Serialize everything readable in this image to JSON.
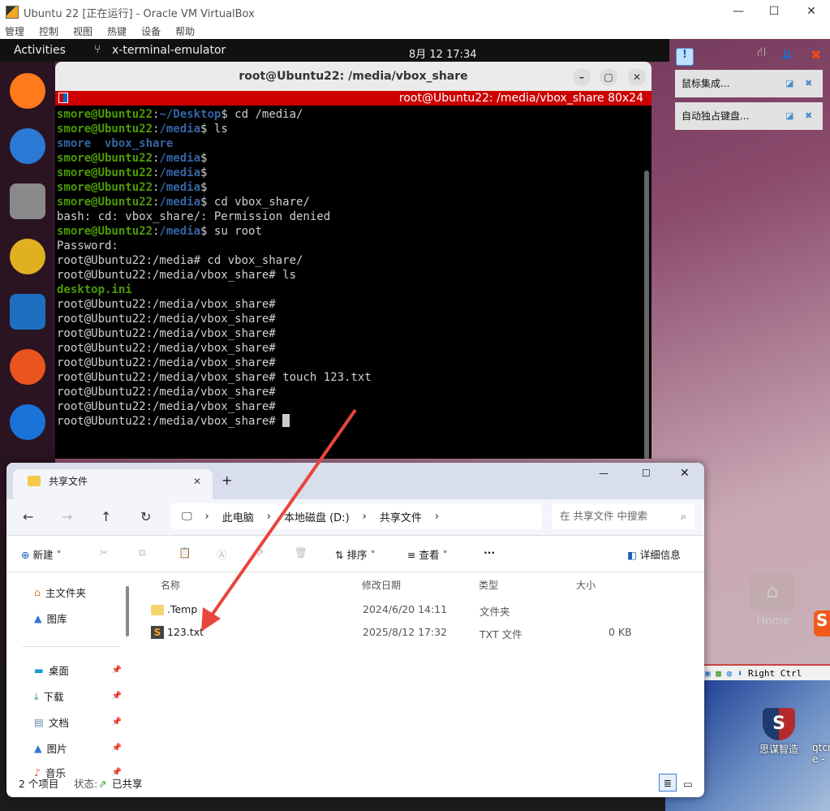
{
  "vbox": {
    "title": "Ubuntu 22 [正在运行] - Oracle VM VirtualBox",
    "menu": [
      "管理",
      "控制",
      "视图",
      "热键",
      "设备",
      "帮助"
    ],
    "status_key": "Right Ctrl"
  },
  "ubuntu": {
    "activities": "Activities",
    "app": "x-terminal-emulator",
    "clock": "8月 12  17:34",
    "home_label": "Home",
    "dock": [
      {
        "name": "firefox-icon",
        "color": "#ff7a1a"
      },
      {
        "name": "thunderbird-icon",
        "color": "#2a7ad5"
      },
      {
        "name": "files-icon",
        "color": "#8a8a8a"
      },
      {
        "name": "rhythmbox-icon",
        "color": "#e0b020"
      },
      {
        "name": "writer-icon",
        "color": "#1e6fc0"
      },
      {
        "name": "app-center-icon",
        "color": "#e9541f"
      },
      {
        "name": "help-icon",
        "color": "#1a73d8"
      }
    ]
  },
  "notifications": [
    {
      "label": "鼠标集成..."
    },
    {
      "label": "自动独占键盘..."
    }
  ],
  "terminal": {
    "title": "root@Ubuntu22: /media/vbox_share",
    "subtitle": "root@Ubuntu22: /media/vbox_share 80x24",
    "lines": [
      [
        {
          "t": "smore@Ubuntu22",
          "c": "u"
        },
        {
          "t": ":",
          "c": "n"
        },
        {
          "t": "~/Desktop",
          "c": "p"
        },
        {
          "t": "$ cd /media/",
          "c": "n"
        }
      ],
      [
        {
          "t": "smore@Ubuntu22",
          "c": "u"
        },
        {
          "t": ":",
          "c": "n"
        },
        {
          "t": "/media",
          "c": "p"
        },
        {
          "t": "$ ls",
          "c": "n"
        }
      ],
      [
        {
          "t": "smore  vbox_share",
          "c": "b"
        }
      ],
      [
        {
          "t": "smore@Ubuntu22",
          "c": "u"
        },
        {
          "t": ":",
          "c": "n"
        },
        {
          "t": "/media",
          "c": "p"
        },
        {
          "t": "$",
          "c": "n"
        }
      ],
      [
        {
          "t": "smore@Ubuntu22",
          "c": "u"
        },
        {
          "t": ":",
          "c": "n"
        },
        {
          "t": "/media",
          "c": "p"
        },
        {
          "t": "$",
          "c": "n"
        }
      ],
      [
        {
          "t": "smore@Ubuntu22",
          "c": "u"
        },
        {
          "t": ":",
          "c": "n"
        },
        {
          "t": "/media",
          "c": "p"
        },
        {
          "t": "$",
          "c": "n"
        }
      ],
      [
        {
          "t": "smore@Ubuntu22",
          "c": "u"
        },
        {
          "t": ":",
          "c": "n"
        },
        {
          "t": "/media",
          "c": "p"
        },
        {
          "t": "$ cd vbox_share/",
          "c": "n"
        }
      ],
      [
        {
          "t": "bash: cd: vbox_share/: Permission denied",
          "c": "n"
        }
      ],
      [
        {
          "t": "smore@Ubuntu22",
          "c": "u"
        },
        {
          "t": ":",
          "c": "n"
        },
        {
          "t": "/media",
          "c": "p"
        },
        {
          "t": "$ su root",
          "c": "n"
        }
      ],
      [
        {
          "t": "Password:",
          "c": "n"
        }
      ],
      [
        {
          "t": "root@Ubuntu22:/media# cd vbox_share/",
          "c": "n"
        }
      ],
      [
        {
          "t": "root@Ubuntu22:/media/vbox_share# ls",
          "c": "n"
        }
      ],
      [
        {
          "t": "desktop.ini",
          "c": "g"
        }
      ],
      [
        {
          "t": "root@Ubuntu22:/media/vbox_share#",
          "c": "n"
        }
      ],
      [
        {
          "t": "root@Ubuntu22:/media/vbox_share#",
          "c": "n"
        }
      ],
      [
        {
          "t": "root@Ubuntu22:/media/vbox_share#",
          "c": "n"
        }
      ],
      [
        {
          "t": "root@Ubuntu22:/media/vbox_share#",
          "c": "n"
        }
      ],
      [
        {
          "t": "root@Ubuntu22:/media/vbox_share#",
          "c": "n"
        }
      ],
      [
        {
          "t": "root@Ubuntu22:/media/vbox_share# touch 123.txt",
          "c": "n"
        }
      ],
      [
        {
          "t": "root@Ubuntu22:/media/vbox_share#",
          "c": "n"
        }
      ],
      [
        {
          "t": "root@Ubuntu22:/media/vbox_share#",
          "c": "n"
        }
      ],
      [
        {
          "t": "root@Ubuntu22:/media/vbox_share# ",
          "c": "n"
        }
      ]
    ]
  },
  "explorer": {
    "tab": "共享文件",
    "crumbs": [
      "此电脑",
      "本地磁盘 (D:)",
      "共享文件"
    ],
    "search_placeholder": "在 共享文件 中搜索",
    "toolbar": {
      "new": "新建",
      "sort": "排序",
      "view": "查看",
      "more": "···",
      "details": "详细信息"
    },
    "nav": [
      {
        "label": "主文件夹",
        "icon": "home-icon"
      },
      {
        "label": "图库",
        "icon": "gallery-icon"
      },
      {
        "label": "桌面",
        "icon": "desktop-icon"
      },
      {
        "label": "下载",
        "icon": "download-icon"
      },
      {
        "label": "文档",
        "icon": "documents-icon"
      },
      {
        "label": "图片",
        "icon": "pictures-icon"
      },
      {
        "label": "音乐",
        "icon": "music-icon"
      }
    ],
    "columns": [
      "名称",
      "修改日期",
      "类型",
      "大小"
    ],
    "files": [
      {
        "name": ".Temp",
        "date": "2024/6/20 14:11",
        "type": "文件夹",
        "size": ""
      },
      {
        "name": "123.txt",
        "date": "2025/8/12 17:32",
        "type": "TXT 文件",
        "size": "0 KB"
      }
    ],
    "status": {
      "count": "2 个项目",
      "state_label": "状态:",
      "state": "已共享"
    }
  },
  "desktop": {
    "icons": [
      "思谋智造",
      "qtcr e -"
    ]
  },
  "annotation_color": "#e8453c"
}
